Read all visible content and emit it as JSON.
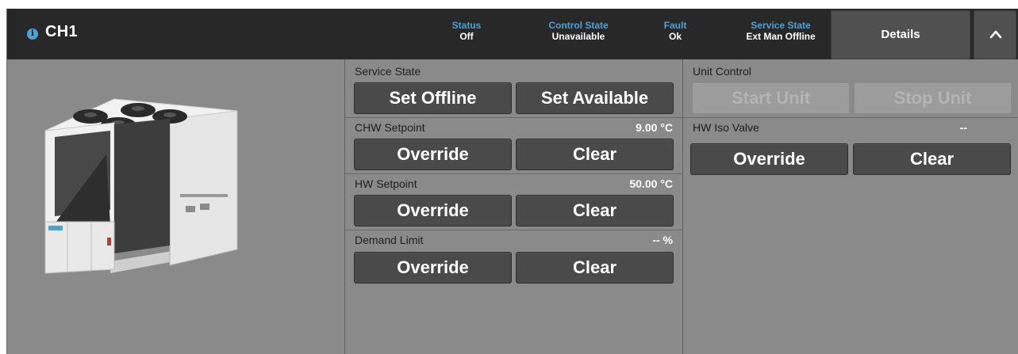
{
  "header": {
    "title": "CH1",
    "stats": [
      {
        "label": "Status",
        "value": "Off"
      },
      {
        "label": "Control State",
        "value": "Unavailable"
      },
      {
        "label": "Fault",
        "value": "Ok"
      },
      {
        "label": "Service State",
        "value": "Ext Man Offline"
      }
    ],
    "details_label": "Details"
  },
  "service_state": {
    "label": "Service State",
    "set_offline": "Set Offline",
    "set_available": "Set Available"
  },
  "chw_setpoint": {
    "label": "CHW Setpoint",
    "value": "9.00 °C",
    "override": "Override",
    "clear": "Clear"
  },
  "hw_setpoint": {
    "label": "HW Setpoint",
    "value": "50.00 °C",
    "override": "Override",
    "clear": "Clear"
  },
  "demand_limit": {
    "label": "Demand Limit",
    "value": "-- %",
    "override": "Override",
    "clear": "Clear"
  },
  "unit_control": {
    "label": "Unit Control",
    "start": "Start Unit",
    "stop": "Stop Unit"
  },
  "hw_iso_valve": {
    "label": "HW Iso Valve",
    "value": "--",
    "override": "Override",
    "clear": "Clear"
  },
  "icons": {
    "info": "info-icon",
    "collapse": "chevron-up-icon",
    "equipment": "chiller-unit-image"
  },
  "colors": {
    "accent": "#4aa3d8",
    "header_bg": "#282828",
    "panel_bg": "#8a8a8a",
    "button_bg": "#4a4a4a"
  }
}
